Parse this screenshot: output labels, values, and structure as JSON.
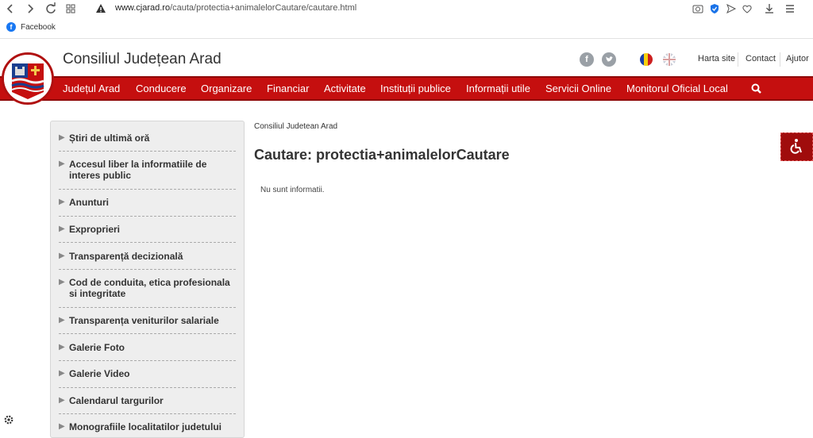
{
  "browser": {
    "url_domain": "www.cjarad.ro",
    "url_path": "/cauta/protectia+animalelorCautare/cautare.html",
    "bookmarks": [
      {
        "label": "Facebook"
      }
    ]
  },
  "header": {
    "site_title": "Consiliul Județean Arad",
    "top_links": [
      "Harta site",
      "Contact",
      "Ajutor"
    ]
  },
  "nav": {
    "items": [
      "Județul Arad",
      "Conducere",
      "Organizare",
      "Financiar",
      "Activitate",
      "Instituții publice",
      "Informații utile",
      "Servicii Online",
      "Monitorul Oficial Local"
    ]
  },
  "sidebar": {
    "items": [
      "Știri de ultimă oră",
      "Accesul liber la informatiile de interes public",
      "Anunturi",
      "Exproprieri",
      "Transparență decizională",
      "Cod de conduita, etica profesionala si integritate",
      "Transparența veniturilor salariale",
      "Galerie Foto",
      "Galerie Video",
      "Calendarul targurilor",
      "Monografiile localitatilor judetului"
    ]
  },
  "main": {
    "breadcrumb": "Consiliul Judetean Arad",
    "title": "Cautare: protectia+animalelorCautare",
    "message": "Nu sunt informatii."
  },
  "colors": {
    "brand_red": "#c50f0f",
    "nav_border": "#8f0707",
    "sidebar_bg": "#eeeeee"
  }
}
